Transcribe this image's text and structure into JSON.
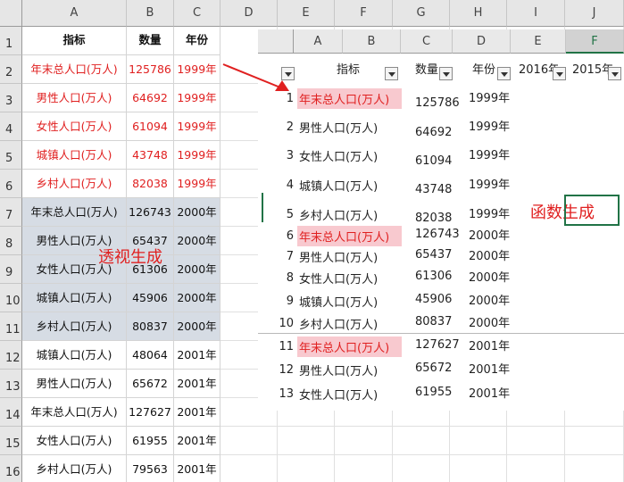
{
  "left_sheet": {
    "columns": [
      "A",
      "B",
      "C",
      "D",
      "E",
      "F",
      "G",
      "H",
      "I",
      "J"
    ],
    "header": {
      "row": "1",
      "indicator": "指标",
      "quantity": "数量",
      "year": "年份"
    },
    "rows": [
      {
        "row": "2",
        "indicator": "年末总人口(万人)",
        "quantity": "125786",
        "year": "1999年",
        "style": "red"
      },
      {
        "row": "3",
        "indicator": "男性人口(万人)",
        "quantity": "64692",
        "year": "1999年",
        "style": "red"
      },
      {
        "row": "4",
        "indicator": "女性人口(万人)",
        "quantity": "61094",
        "year": "1999年",
        "style": "red"
      },
      {
        "row": "5",
        "indicator": "城镇人口(万人)",
        "quantity": "43748",
        "year": "1999年",
        "style": "red"
      },
      {
        "row": "6",
        "indicator": "乡村人口(万人)",
        "quantity": "82038",
        "year": "1999年",
        "style": "red"
      },
      {
        "row": "7",
        "indicator": "年末总人口(万人)",
        "quantity": "126743",
        "year": "2000年",
        "style": "gray"
      },
      {
        "row": "8",
        "indicator": "男性人口(万人)",
        "quantity": "65437",
        "year": "2000年",
        "style": "gray"
      },
      {
        "row": "9",
        "indicator": "女性人口(万人)",
        "quantity": "61306",
        "year": "2000年",
        "style": "gray"
      },
      {
        "row": "10",
        "indicator": "城镇人口(万人)",
        "quantity": "45906",
        "year": "2000年",
        "style": "gray"
      },
      {
        "row": "11",
        "indicator": "乡村人口(万人)",
        "quantity": "80837",
        "year": "2000年",
        "style": "gray"
      },
      {
        "row": "12",
        "indicator": "城镇人口(万人)",
        "quantity": "48064",
        "year": "2001年",
        "style": "plain"
      },
      {
        "row": "13",
        "indicator": "男性人口(万人)",
        "quantity": "65672",
        "year": "2001年",
        "style": "plain"
      },
      {
        "row": "14",
        "indicator": "年末总人口(万人)",
        "quantity": "127627",
        "year": "2001年",
        "style": "plain"
      },
      {
        "row": "15",
        "indicator": "女性人口(万人)",
        "quantity": "61955",
        "year": "2001年",
        "style": "plain"
      },
      {
        "row": "16",
        "indicator": "乡村人口(万人)",
        "quantity": "79563",
        "year": "2001年",
        "style": "plain"
      }
    ],
    "annotation": "透视生成"
  },
  "right_sheet": {
    "columns": [
      "A",
      "B",
      "C",
      "D",
      "E",
      "F"
    ],
    "filter_header": {
      "indicator": "指标",
      "quantity": "数量",
      "year": "年份",
      "e": "2016年",
      "f": "2015年"
    },
    "rows": [
      {
        "num": "1",
        "indicator": "年末总人口(万人)",
        "quantity": "125786",
        "year": "1999年",
        "highlight": true
      },
      {
        "num": "2",
        "indicator": "男性人口(万人)",
        "quantity": "64692",
        "year": "1999年",
        "highlight": false
      },
      {
        "num": "3",
        "indicator": "女性人口(万人)",
        "quantity": "61094",
        "year": "1999年",
        "highlight": false
      },
      {
        "num": "4",
        "indicator": "城镇人口(万人)",
        "quantity": "43748",
        "year": "1999年",
        "highlight": false
      },
      {
        "num": "5",
        "indicator": "乡村人口(万人)",
        "quantity": "82038",
        "year": "1999年",
        "highlight": false
      },
      {
        "num": "6",
        "indicator": "年末总人口(万人)",
        "quantity": "126743",
        "year": "2000年",
        "highlight": true
      },
      {
        "num": "7",
        "indicator": "男性人口(万人)",
        "quantity": "65437",
        "year": "2000年",
        "highlight": false
      },
      {
        "num": "8",
        "indicator": "女性人口(万人)",
        "quantity": "61306",
        "year": "2000年",
        "highlight": false
      },
      {
        "num": "9",
        "indicator": "城镇人口(万人)",
        "quantity": "45906",
        "year": "2000年",
        "highlight": false
      },
      {
        "num": "10",
        "indicator": "乡村人口(万人)",
        "quantity": "80837",
        "year": "2000年",
        "highlight": false
      },
      {
        "num": "11",
        "indicator": "年末总人口(万人)",
        "quantity": "127627",
        "year": "2001年",
        "highlight": true
      },
      {
        "num": "12",
        "indicator": "男性人口(万人)",
        "quantity": "65672",
        "year": "2001年",
        "highlight": false
      },
      {
        "num": "13",
        "indicator": "女性人口(万人)",
        "quantity": "61955",
        "year": "2001年",
        "highlight": false
      }
    ],
    "annotation": "函数生成"
  },
  "colors": {
    "red": "#e02020",
    "gray_band": "#d6dce4",
    "pink": "#f8c9cf",
    "selection": "#217346"
  }
}
